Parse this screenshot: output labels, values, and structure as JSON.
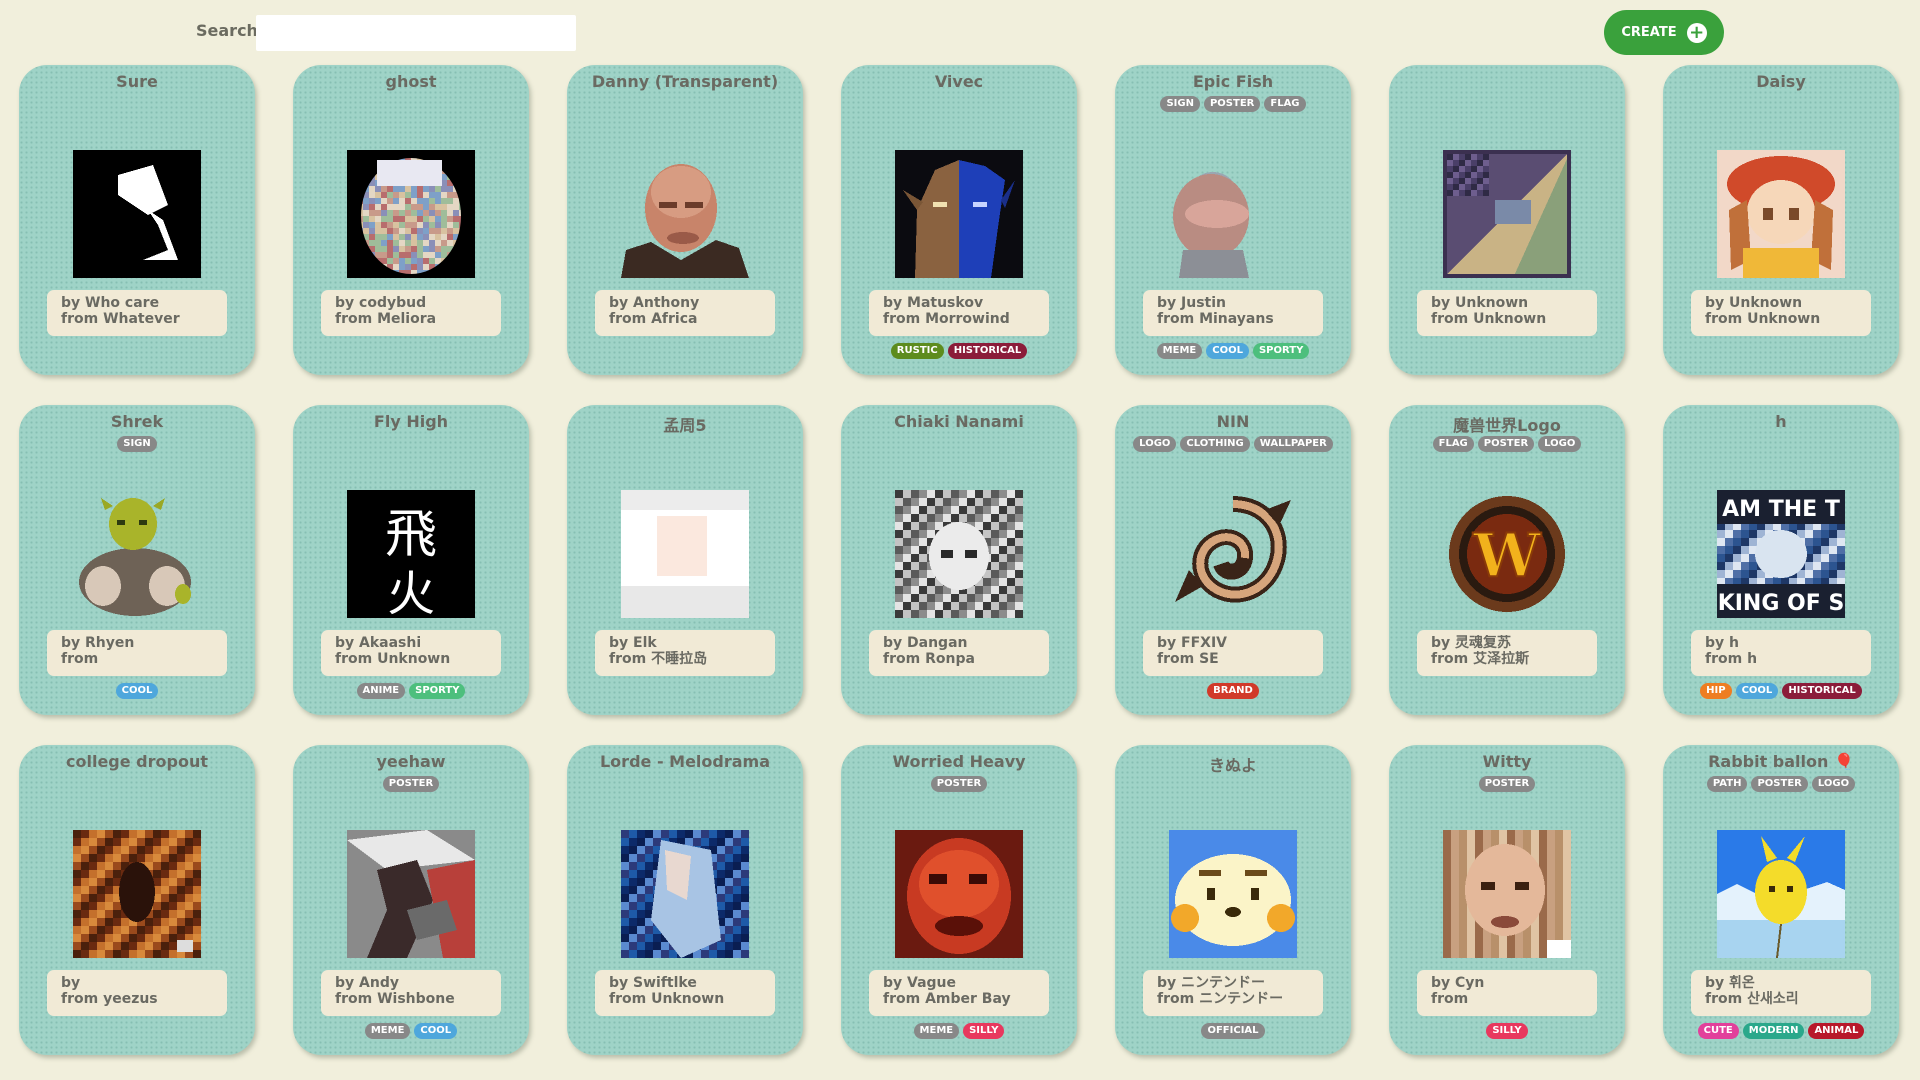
{
  "search": {
    "label": "Search:",
    "value": ""
  },
  "create_button": {
    "label": "CREATE"
  },
  "tag_colors": {
    "SIGN": "#888888",
    "POSTER": "#888888",
    "FLAG": "#888888",
    "LOGO": "#888888",
    "CLOTHING": "#888888",
    "WALLPAPER": "#888888",
    "PATH": "#888888",
    "MEME": "#888888",
    "ANIME": "#888888",
    "OFFICIAL": "#888888",
    "COOL": "#4ea7dc",
    "SPORTY": "#4dbf7d",
    "RUSTIC": "#5d8c1e",
    "HISTORICAL": "#8b1c3a",
    "BRAND": "#d13a2a",
    "SILLY": "#e8385e",
    "HIP": "#ee7d22",
    "CUTE": "#e2409b",
    "MODERN": "#2aa88b",
    "ANIMAL": "#b8182a"
  },
  "cards": [
    {
      "title": "Sure",
      "top_tags": [],
      "by": "by Who care",
      "from": "from Whatever",
      "bottom_tags": [],
      "thumb": "bw-gramophone"
    },
    {
      "title": "ghost",
      "top_tags": [],
      "by": "by codybud",
      "from": "from Meliora",
      "bottom_tags": [],
      "thumb": "noise-ghost"
    },
    {
      "title": "Danny (Transparent)",
      "top_tags": [],
      "by": "by Anthony",
      "from": "from Africa",
      "bottom_tags": [],
      "thumb": "portrait-bald"
    },
    {
      "title": "Vivec",
      "top_tags": [],
      "by": "by Matuskov",
      "from": "from Morrowind",
      "bottom_tags": [
        "RUSTIC",
        "HISTORICAL"
      ],
      "thumb": "vivec-face"
    },
    {
      "title": "Epic Fish",
      "top_tags": [
        "SIGN",
        "POSTER",
        "FLAG"
      ],
      "by": "by Justin",
      "from": "from Minayans",
      "bottom_tags": [
        "MEME",
        "COOL",
        "SPORTY"
      ],
      "thumb": "fish"
    },
    {
      "title": "",
      "top_tags": [],
      "by": "by Unknown",
      "from": "from Unknown",
      "bottom_tags": [],
      "thumb": "diag-frame"
    },
    {
      "title": "Daisy",
      "top_tags": [],
      "by": "by Unknown",
      "from": "from Unknown",
      "bottom_tags": [],
      "thumb": "daisy"
    },
    {
      "title": "Shrek",
      "top_tags": [
        "SIGN"
      ],
      "by": "by Rhyen",
      "from": "from",
      "bottom_tags": [
        "COOL"
      ],
      "thumb": "shrek"
    },
    {
      "title": "Fly High",
      "top_tags": [],
      "by": "by Akaashi",
      "from": "from Unknown",
      "bottom_tags": [
        "ANIME",
        "SPORTY"
      ],
      "thumb": "kanji"
    },
    {
      "title": "孟周5",
      "top_tags": [],
      "by": "by Elk",
      "from": "from 不睡拉岛",
      "bottom_tags": [],
      "thumb": "pale-blocks"
    },
    {
      "title": "Chiaki Nanami",
      "top_tags": [],
      "by": "by Dangan",
      "from": "from Ronpa",
      "bottom_tags": [],
      "thumb": "anime-bw"
    },
    {
      "title": "NIN",
      "top_tags": [
        "LOGO",
        "CLOTHING",
        "WALLPAPER"
      ],
      "by": "by FFXIV",
      "from": "from SE",
      "bottom_tags": [
        "BRAND"
      ],
      "thumb": "swirl"
    },
    {
      "title": "魔兽世界Logo",
      "top_tags": [
        "FLAG",
        "POSTER",
        "LOGO"
      ],
      "by": "by 灵魂复苏",
      "from": "from 艾泽拉斯",
      "bottom_tags": [],
      "thumb": "wow-logo"
    },
    {
      "title": "h",
      "top_tags": [],
      "by": "by h",
      "from": "from h",
      "bottom_tags": [
        "HIP",
        "COOL",
        "HISTORICAL"
      ],
      "thumb": "meme-text",
      "thumb_text_top": "AM THE T",
      "thumb_text_bottom": "KING OF S"
    },
    {
      "title": "college dropout",
      "top_tags": [],
      "by": "by",
      "from": "from yeezus",
      "bottom_tags": [],
      "thumb": "dropout"
    },
    {
      "title": "yeehaw",
      "top_tags": [
        "POSTER"
      ],
      "by": "by Andy",
      "from": "from Wishbone",
      "bottom_tags": [
        "MEME",
        "COOL"
      ],
      "thumb": "cowboy"
    },
    {
      "title": "Lorde - Melodrama",
      "top_tags": [],
      "by": "by Swiftlke",
      "from": "from Unknown",
      "bottom_tags": [],
      "thumb": "melodrama"
    },
    {
      "title": "Worried Heavy",
      "top_tags": [
        "POSTER"
      ],
      "by": "by Vague",
      "from": "from Amber Bay",
      "bottom_tags": [
        "MEME",
        "SILLY"
      ],
      "thumb": "heavy"
    },
    {
      "title": "きぬよ",
      "top_tags": [],
      "by": "by ニンテンドー",
      "from": "from ニンテンドー",
      "bottom_tags": [
        "OFFICIAL"
      ],
      "thumb": "bear"
    },
    {
      "title": "Witty",
      "top_tags": [
        "POSTER"
      ],
      "by": "by Cyn",
      "from": "from",
      "bottom_tags": [
        "SILLY"
      ],
      "thumb": "witty"
    },
    {
      "title": "Rabbit ballon 🎈",
      "top_tags": [
        "PATH",
        "POSTER",
        "LOGO"
      ],
      "by": "by 휘온",
      "from": "from 산새소리",
      "bottom_tags": [
        "CUTE",
        "MODERN",
        "ANIMAL"
      ],
      "thumb": "balloon"
    }
  ]
}
